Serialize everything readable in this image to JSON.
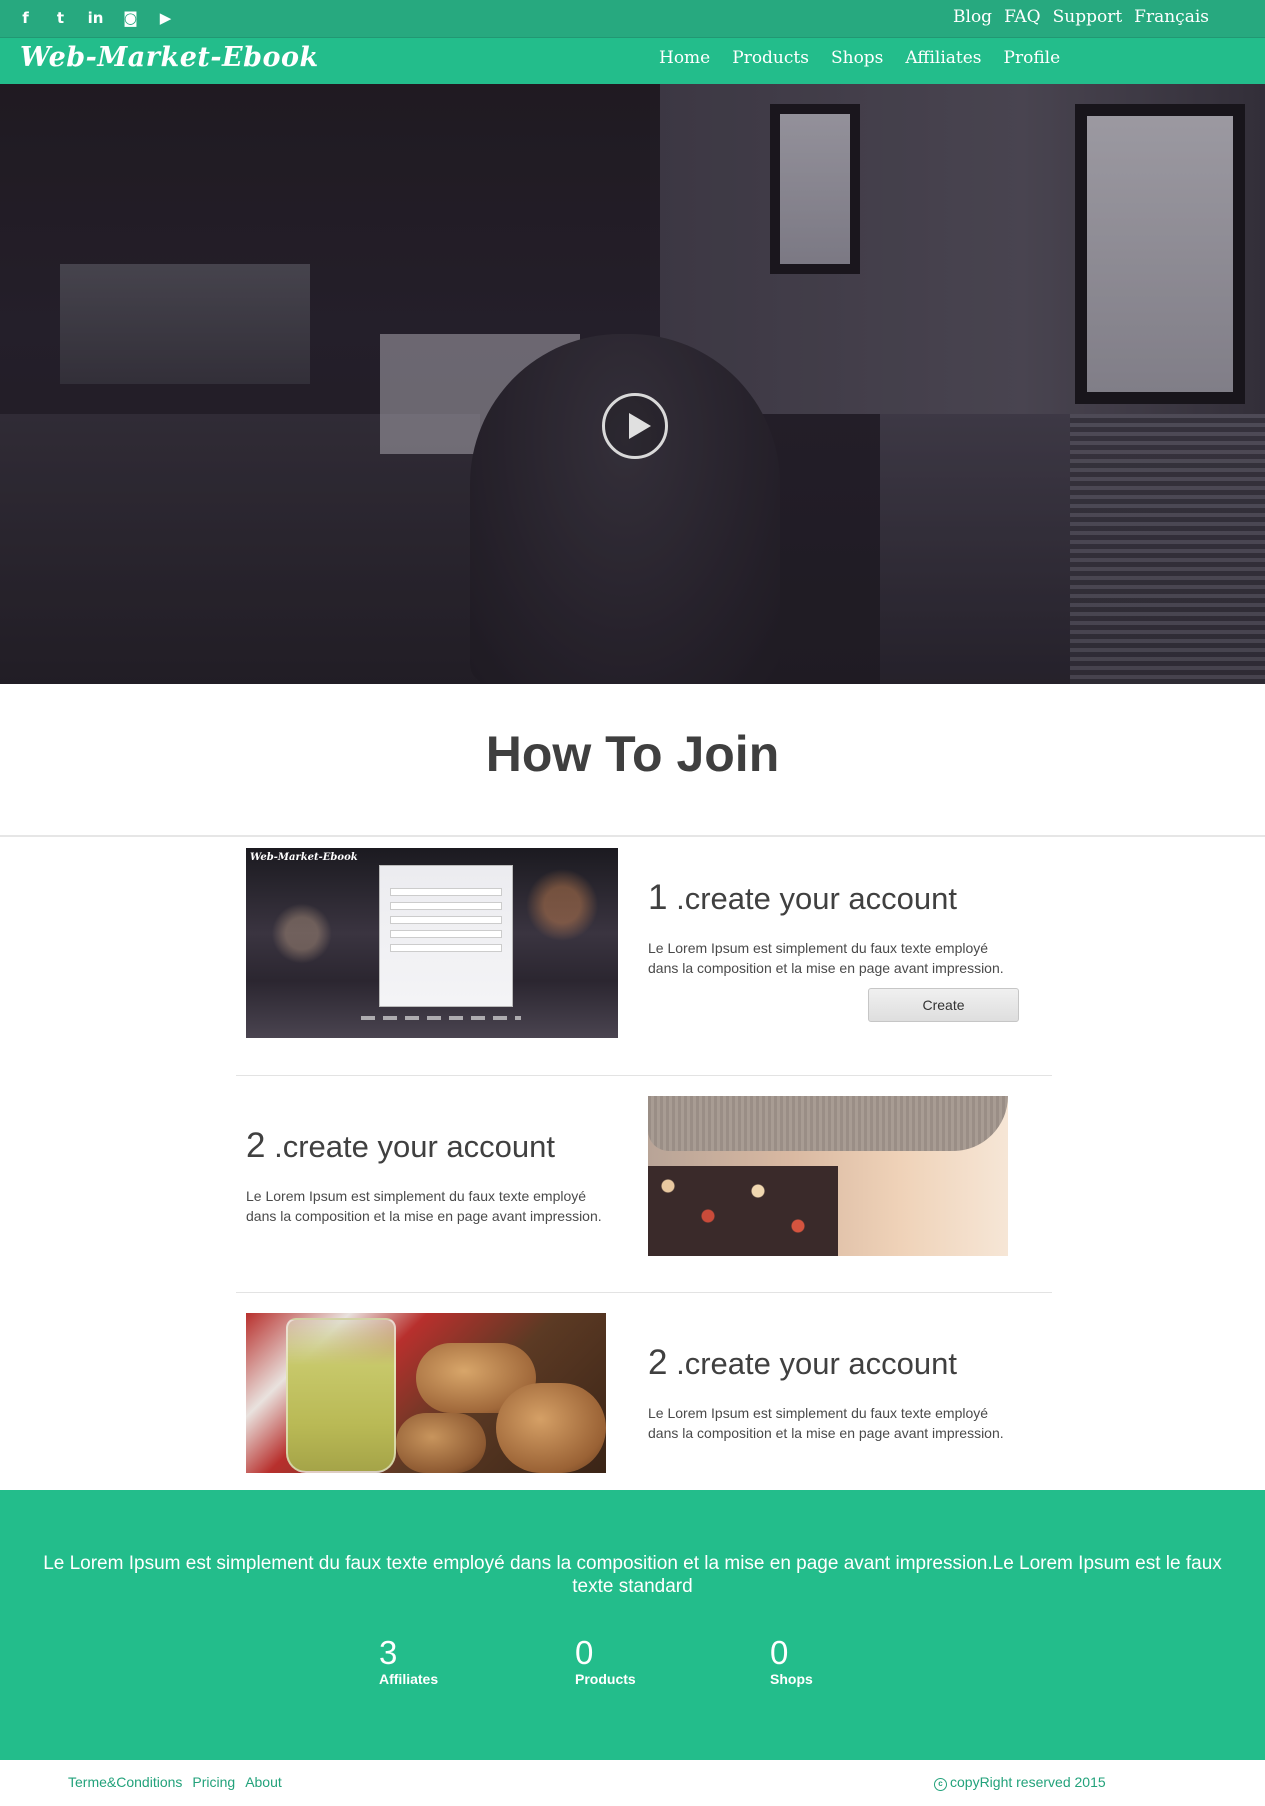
{
  "social": {
    "icons": [
      "facebook-icon",
      "twitter-icon",
      "linkedin-icon",
      "instagram-icon",
      "youtube-icon"
    ],
    "glyphs": [
      "f",
      "t",
      "in",
      "◙",
      "▶"
    ]
  },
  "utility_nav": [
    "Blog",
    "FAQ",
    "Support",
    "Français"
  ],
  "brand": {
    "logo": "Web-Market-Ebook",
    "accent": "#23bd8b",
    "dark_accent": "#27a97f"
  },
  "main_nav": [
    "Home",
    "Products",
    "Shops",
    "Affiliates",
    "Profile"
  ],
  "hero": {
    "play_icon": "play-icon"
  },
  "how_to_join": {
    "title": "How To Join",
    "steps": [
      {
        "number": "1",
        "title": " .create your account",
        "text": "Le Lorem Ipsum est simplement du faux texte employé dans la composition et la mise en page avant impression.",
        "button": "Create",
        "thumb_logo": "Web-Market-Ebook"
      },
      {
        "number": "2",
        "title": " .create your account",
        "text": "Le Lorem Ipsum est simplement du faux texte employé dans la composition et la mise en page avant impression."
      },
      {
        "number": "2",
        "title": " .create your account",
        "text": "Le Lorem Ipsum est simplement du faux texte employé dans la composition et la mise en page avant impression."
      }
    ]
  },
  "stats_band": {
    "text": "Le Lorem Ipsum est simplement du faux texte employé dans la composition et la mise en page avant impression.Le Lorem Ipsum est le faux texte standard",
    "stats": [
      {
        "value": "3",
        "label": "Affiliates"
      },
      {
        "value": "0",
        "label": "Products"
      },
      {
        "value": "0",
        "label": "Shops"
      }
    ]
  },
  "footer": {
    "links": [
      "Terme&Conditions",
      "Pricing",
      "About"
    ],
    "copyright_symbol": "c",
    "copyright": "copyRight reserved 2015"
  }
}
